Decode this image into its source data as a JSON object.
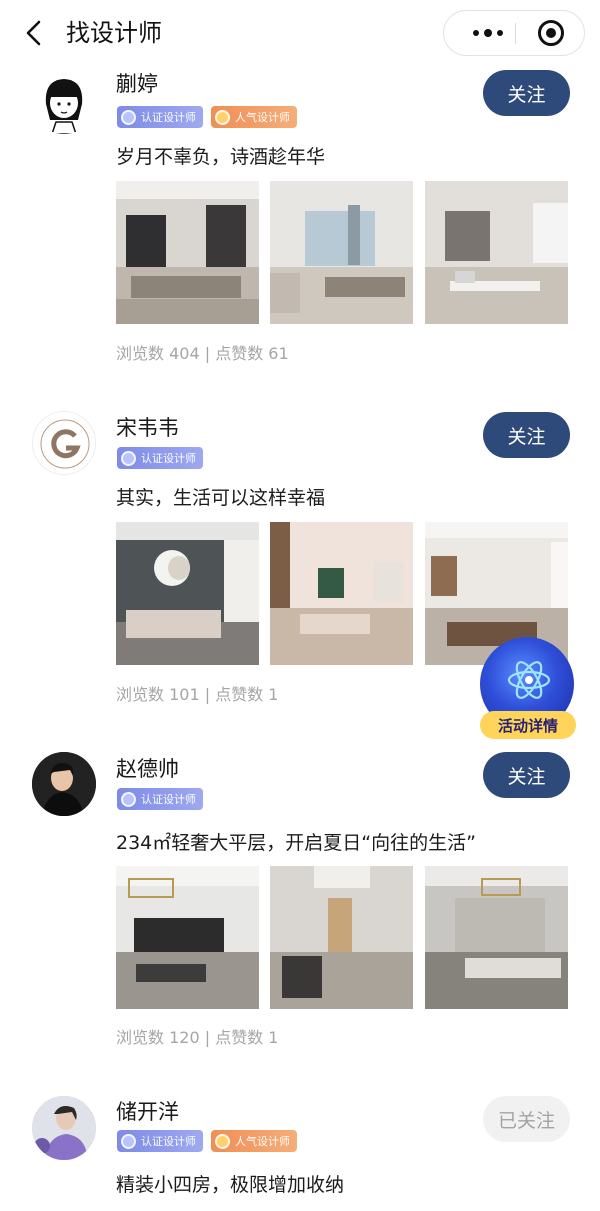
{
  "header": {
    "title": "找设计师"
  },
  "designers": [
    {
      "name": "蒯婷",
      "badges": [
        "认证设计师",
        "人气设计师"
      ],
      "follow": "关注",
      "followed": false,
      "desc": "岁月不辜负，诗酒趁年华",
      "stats": "浏览数 404 | 点赞数 61"
    },
    {
      "name": "宋韦韦",
      "badges": [
        "认证设计师"
      ],
      "follow": "关注",
      "followed": false,
      "desc": "其实，生活可以这样幸福",
      "stats": "浏览数 101 | 点赞数 1"
    },
    {
      "name": "赵德帅",
      "badges": [
        "认证设计师"
      ],
      "follow": "关注",
      "followed": false,
      "desc": "234㎡轻奢大平层，开启夏日“向往的生活”",
      "stats": "浏览数 120 | 点赞数 1"
    },
    {
      "name": "储开洋",
      "badges": [
        "认证设计师",
        "人气设计师"
      ],
      "follow": "已关注",
      "followed": true,
      "desc": "精装小四房，极限增加收纳"
    }
  ],
  "float_button": {
    "label": "活动详情"
  },
  "colors": {
    "follow_button": "#2d4a7b",
    "followed_button": "#f1f1f1",
    "cert_badge": "#8a96ec",
    "pop_badge": "#f29a62",
    "stats_text": "#a5a5a5"
  }
}
